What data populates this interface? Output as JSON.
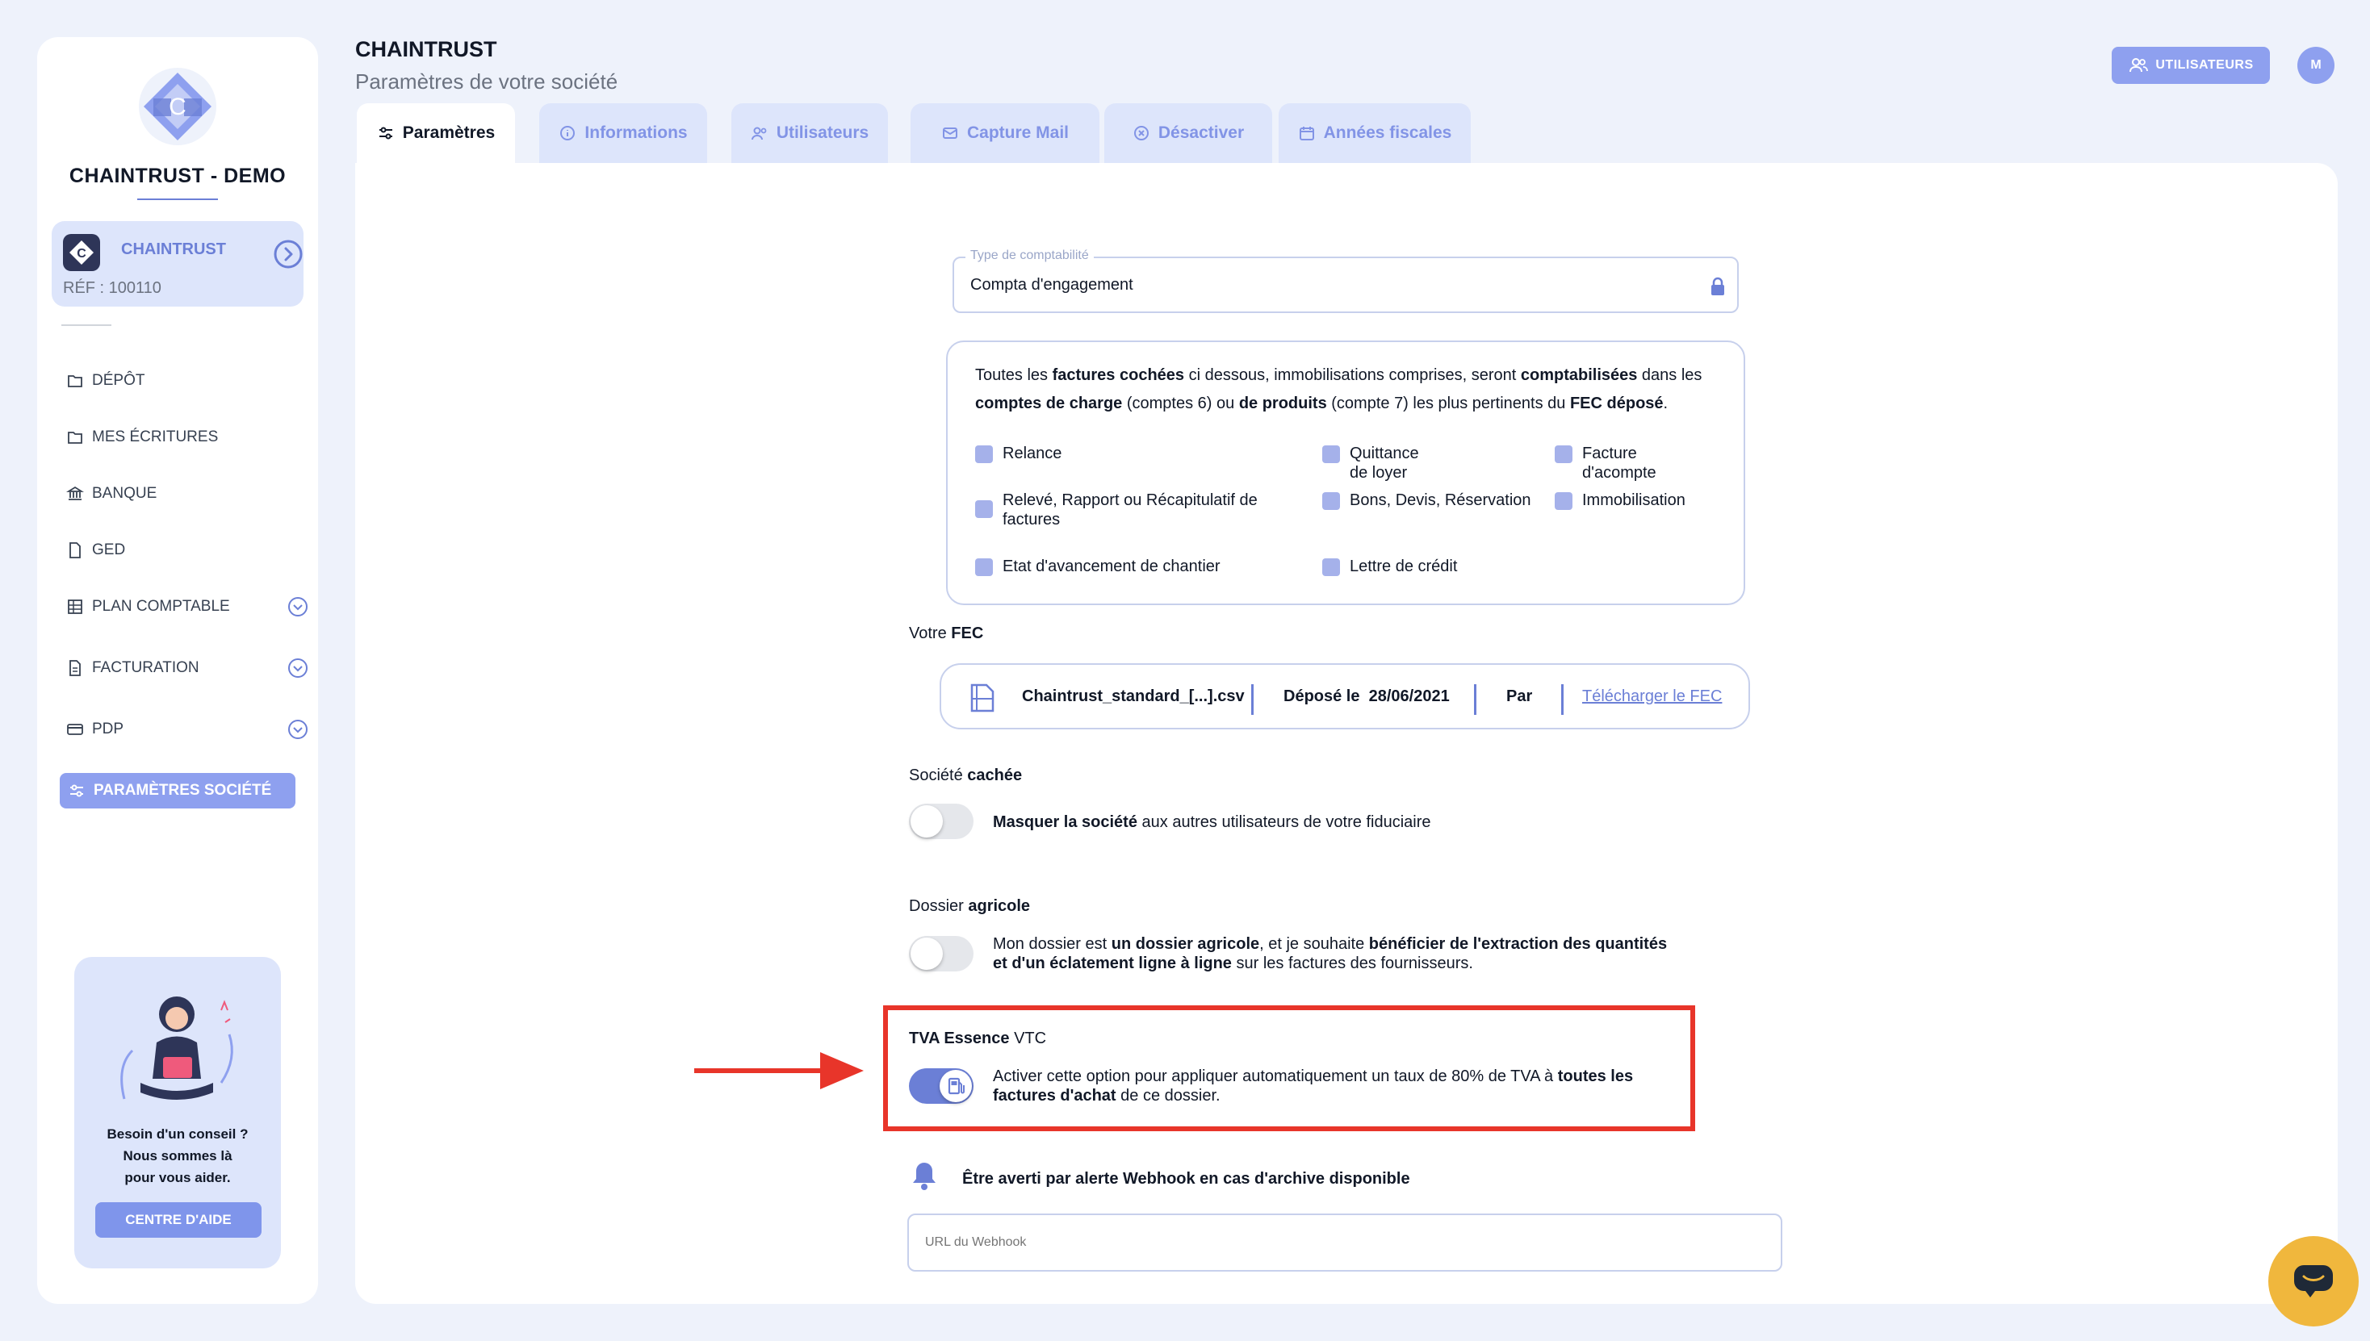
{
  "colors": {
    "accent": "#6b7fd6",
    "accent_light": "#8ea0ef",
    "bg": "#eef2fb",
    "highlight": "#e8352a",
    "chat": "#f0b73d"
  },
  "sidebar": {
    "company_name": "CHAINTRUST - DEMO",
    "company_card": {
      "name": "CHAINTRUST",
      "ref": "RÉF : 100110"
    },
    "items": [
      {
        "label": "DÉPÔT",
        "icon": "upload-folder-icon"
      },
      {
        "label": "MES ÉCRITURES",
        "icon": "folder-icon"
      },
      {
        "label": "BANQUE",
        "icon": "bank-icon"
      },
      {
        "label": "GED",
        "icon": "document-icon"
      },
      {
        "label": "PLAN COMPTABLE",
        "icon": "table-icon"
      },
      {
        "label": "FACTURATION",
        "icon": "invoice-icon"
      },
      {
        "label": "PDP",
        "icon": "card-icon"
      },
      {
        "label": "PARAMÈTRES SOCIÉTÉ",
        "icon": "settings-icon"
      }
    ],
    "help": {
      "line1": "Besoin d'un conseil ?",
      "line2": "Nous sommes là",
      "line3": "pour vous aider.",
      "button": "CENTRE D'AIDE"
    }
  },
  "header": {
    "title": "CHAINTRUST",
    "subtitle": "Paramètres de votre société",
    "users_button": "UTILISATEURS",
    "avatar_initial": "M"
  },
  "tabs": [
    {
      "label": "Paramètres",
      "active": true
    },
    {
      "label": "Informations",
      "active": false
    },
    {
      "label": "Utilisateurs",
      "active": false
    },
    {
      "label": "Capture Mail",
      "active": false
    },
    {
      "label": "Désactiver",
      "active": false
    },
    {
      "label": "Années fiscales",
      "active": false
    }
  ],
  "form": {
    "accounting_type": {
      "label": "Type de comptabilité",
      "value": "Compta d'engagement"
    },
    "invoice_description": {
      "p1": "Toutes les ",
      "b1": "factures cochées",
      "p2": " ci dessous, immobilisations comprises, seront ",
      "b2": "comptabilisées",
      "p3": " dans les ",
      "b3": "comptes de charge",
      "p4": " (comptes 6) ou ",
      "b4": "de produits",
      "p5": " (compte 7) les plus pertinents du ",
      "b5": "FEC déposé",
      "p6": "."
    },
    "invoice_types": [
      "Relance",
      "Quittance de loyer",
      "Facture d'acompte",
      "Relevé, Rapport ou Récapitulatif de factures",
      "Bons, Devis, Réservation",
      "Immobilisation",
      "Etat d'avancement de chantier",
      "Lettre de crédit"
    ],
    "fec": {
      "label_prefix": "Votre ",
      "label_bold": "FEC",
      "filename": "Chaintrust_standard_[...].csv",
      "deposited_label": "Déposé le",
      "deposited_date": "28/06/2021",
      "by_label": "Par",
      "download_link": "Télécharger le FEC"
    },
    "hidden_company": {
      "title_prefix": "Société ",
      "title_bold": "cachée",
      "desc_bold": "Masquer la société",
      "desc_rest": " aux autres utilisateurs de votre fiduciaire",
      "enabled": false
    },
    "agricultural": {
      "title_prefix": "Dossier ",
      "title_bold": "agricole",
      "d1": "Mon dossier est ",
      "d2": "un dossier agricole",
      "d3": ", et je souhaite ",
      "d4": "bénéficier de l'extraction des quantités et d'un éclatement ligne à ligne",
      "d5": " sur les factures des fournisseurs.",
      "enabled": false
    },
    "vat_fuel": {
      "title_bold": "TVA Essence",
      "title_rest": " VTC",
      "d1": "Activer cette option pour appliquer automatiquement un taux de 80% de TVA à ",
      "d2": "toutes les factures d'achat",
      "d3": " de ce dossier.",
      "enabled": true
    },
    "webhook": {
      "title": "Être averti par alerte Webhook en cas d'archive disponible",
      "placeholder": "URL du Webhook"
    }
  }
}
